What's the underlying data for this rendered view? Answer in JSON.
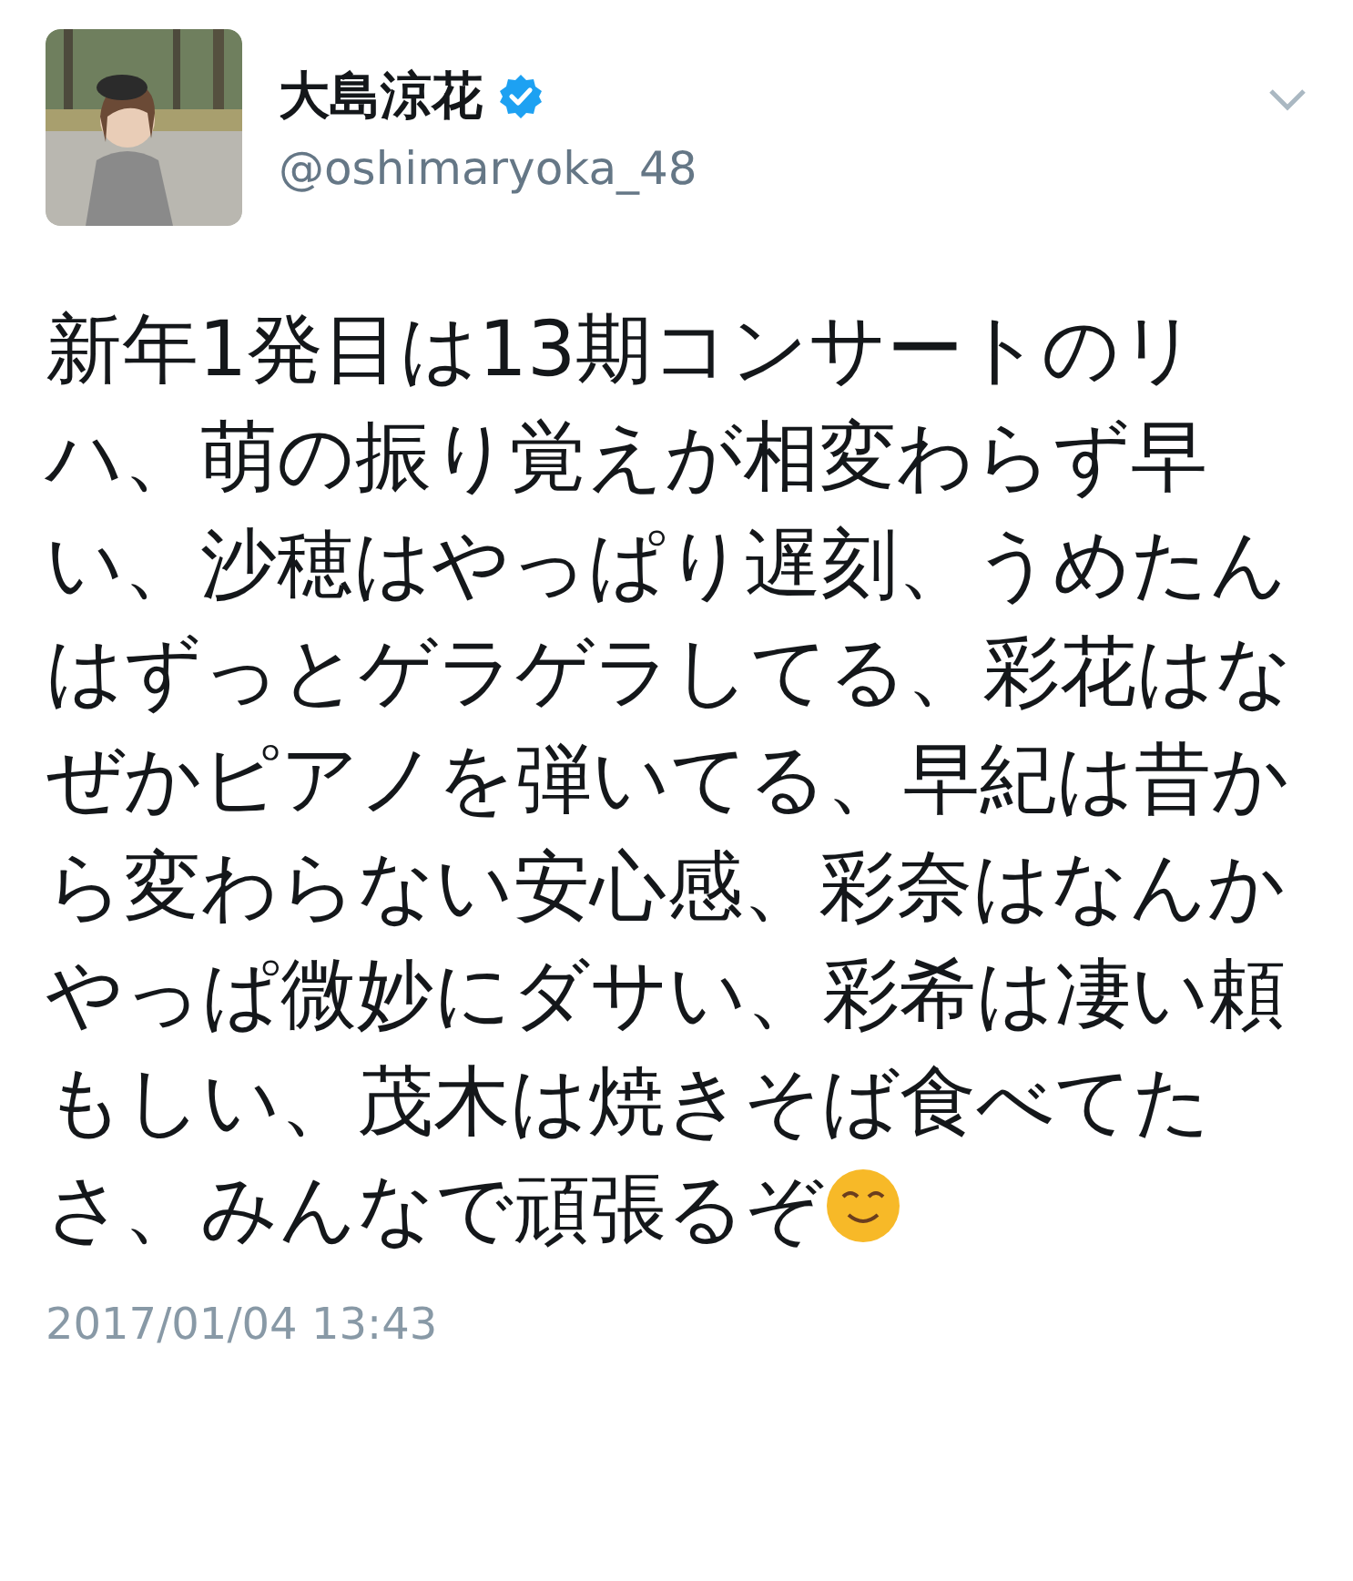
{
  "author": {
    "name": "大島涼花",
    "verified": true,
    "handle": "@oshimaryoka_48"
  },
  "menu": {
    "expanded": false
  },
  "body": [
    "新年1発目は13期コンサートのリハ、萌の振り覚えが相変わらず早い、沙穂はやっぱり遅刻、うめたんはずっとゲラゲラしてる、彩花はなぜかピアノを弾いてる、早紀は昔から変わらない安心感、彩奈はなんかやっぱ微妙にダサい、彩希は凄い頼もしい、茂木は焼きそば食べてた",
    "さ、みんなで頑張るぞ"
  ],
  "timestamp": "2017/01/04 13:43"
}
